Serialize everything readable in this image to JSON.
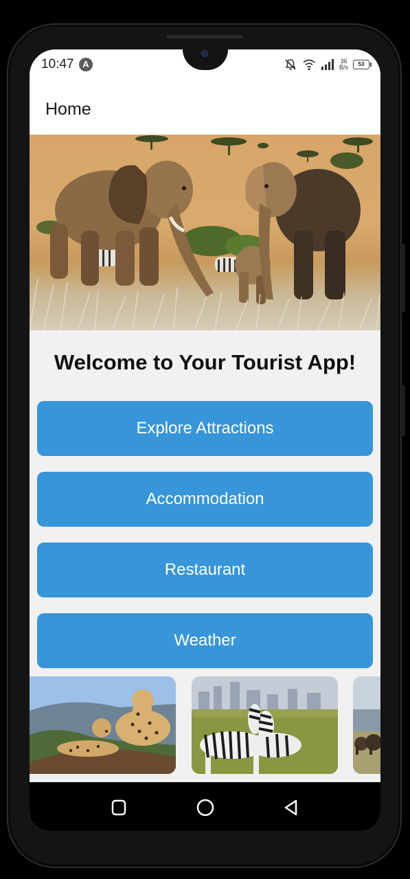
{
  "status_bar": {
    "time": "10:47",
    "app_badge": "A",
    "net_speed_value": "36",
    "net_speed_unit": "B/s",
    "battery": "53"
  },
  "app_bar": {
    "title": "Home"
  },
  "main": {
    "welcome": "Welcome to Your Tourist App!",
    "buttons": [
      {
        "label": "Explore Attractions"
      },
      {
        "label": "Accommodation"
      },
      {
        "label": "Restaurant"
      },
      {
        "label": "Weather"
      }
    ]
  },
  "gallery": {
    "items": [
      {
        "subject": "cheetahs"
      },
      {
        "subject": "zebras"
      },
      {
        "subject": "elephants"
      }
    ]
  },
  "navigation": {
    "icons": [
      "recents-icon",
      "home-icon",
      "back-icon"
    ]
  },
  "colors": {
    "accent": "#3795d9",
    "background": "#f1f1f1"
  }
}
